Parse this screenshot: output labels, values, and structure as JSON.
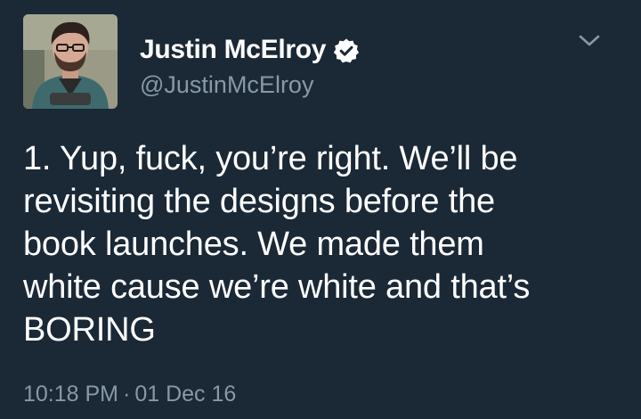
{
  "author": {
    "display_name": "Justin McElroy",
    "handle": "@JustinMcElroy",
    "verified": true
  },
  "tweet": {
    "lines": [
      "1. Yup, fuck, you’re right. We’ll be",
      "revisiting the designs before the",
      "book launches. We made them",
      "white cause we’re white and that’s",
      "BORING"
    ],
    "time": "10:18 PM",
    "separator": "·",
    "date": "01 Dec 16"
  },
  "icons": {
    "verified": "verified-badge-icon",
    "menu": "chevron-down-icon"
  },
  "colors": {
    "background": "#1b2836",
    "text": "#ffffff",
    "secondary": "#8899a6"
  }
}
